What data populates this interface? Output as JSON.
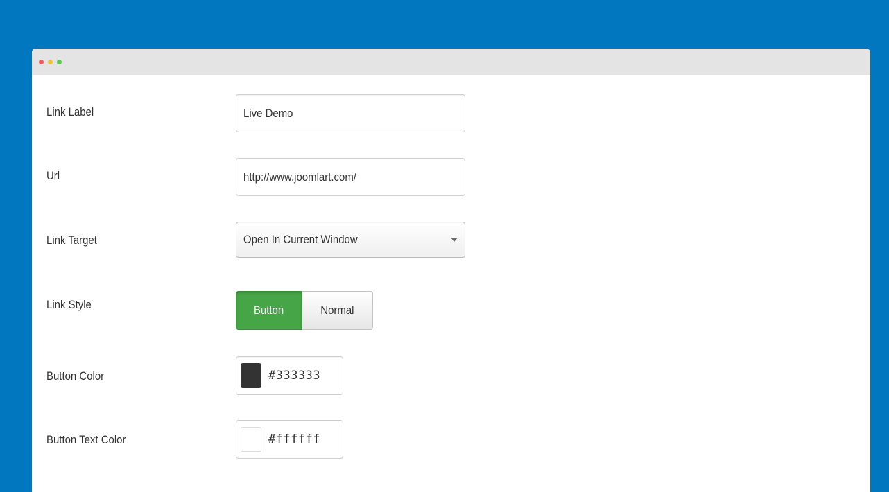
{
  "form": {
    "link_label": {
      "label": "Link Label",
      "value": "Live Demo"
    },
    "url": {
      "label": "Url",
      "value": "http://www.joomlart.com/"
    },
    "link_target": {
      "label": "Link Target",
      "selected": "Open In Current Window"
    },
    "link_style": {
      "label": "Link Style",
      "options": [
        "Button",
        "Normal"
      ],
      "selected": "Button"
    },
    "button_color": {
      "label": "Button Color",
      "value": "#333333"
    },
    "button_text_color": {
      "label": "Button Text Color",
      "value": "#ffffff"
    }
  },
  "colors": {
    "page_background": "#0077be",
    "active_toggle": "#46a546"
  }
}
